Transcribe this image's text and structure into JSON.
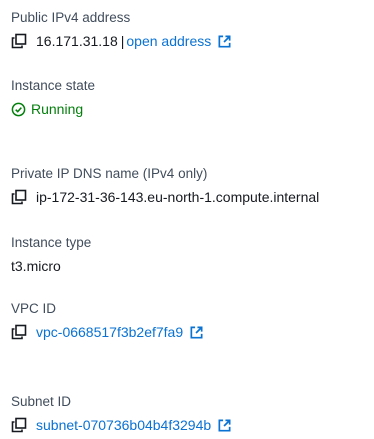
{
  "public_ipv4": {
    "label": "Public IPv4 address",
    "value": "16.171.31.18",
    "separator": "|",
    "link_text": "open address",
    "copy_icon": "copy-icon",
    "external_icon": "external-link-icon"
  },
  "instance_state": {
    "label": "Instance state",
    "value": "Running",
    "status_icon": "check-circle-icon",
    "status_color": "#037f0c"
  },
  "private_dns": {
    "label": "Private IP DNS name (IPv4 only)",
    "value": "ip-172-31-36-143.eu-north-1.compute.internal",
    "copy_icon": "copy-icon"
  },
  "instance_type": {
    "label": "Instance type",
    "value": "t3.micro"
  },
  "vpc": {
    "label": "VPC ID",
    "value": "vpc-0668517f3b2ef7fa9",
    "copy_icon": "copy-icon",
    "external_icon": "external-link-icon"
  },
  "subnet": {
    "label": "Subnet ID",
    "value": "subnet-070736b04b4f3294b",
    "copy_icon": "copy-icon",
    "external_icon": "external-link-icon"
  },
  "colors": {
    "link": "#0972d3",
    "label": "#414d5c",
    "text": "#16191f",
    "success": "#037f0c"
  }
}
